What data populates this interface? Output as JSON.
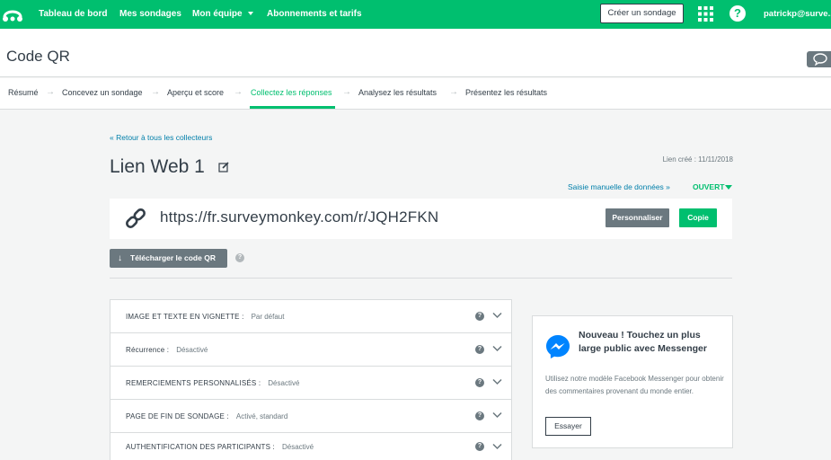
{
  "nav": {
    "links": [
      "Tableau de bord",
      "Mes sondages",
      "Mon équipe",
      "Abonnements et tarifs"
    ],
    "create_button": "Créer un sondage",
    "help_label": "?",
    "user": "patrickp@surve..."
  },
  "header": {
    "title": "Code QR"
  },
  "steps": {
    "items": [
      "Résumé",
      "Concevez un sondage",
      "Aperçu et score",
      "Collectez les réponses",
      "Analysez les résultats",
      "Présentez les résultats"
    ],
    "active_index": 3
  },
  "collector": {
    "back_link": "« Retour à tous les collecteurs",
    "name": "Lien Web 1",
    "created": "Lien créé : 11/11/2018",
    "manual_entry": "Saisie manuelle de données »",
    "status": "OUVERT",
    "url": "https://fr.surveymonkey.com/r/JQH2FKN",
    "personalize_button": "Personnaliser",
    "copy_button": "Copie",
    "download_qr_button": "Télécharger le code QR"
  },
  "settings": [
    {
      "label": "IMAGE ET TEXTE EN VIGNETTE :",
      "value": "Par défaut"
    },
    {
      "label": "Récurrence :",
      "value": "Désactivé"
    },
    {
      "label": "REMERCIEMENTS PERSONNALISÉS :",
      "value": "Désactivé"
    },
    {
      "label": "PAGE DE FIN DE SONDAGE :",
      "value": "Activé, standard"
    },
    {
      "label": "AUTHENTIFICATION DES PARTICIPANTS :",
      "value": "Désactivé"
    }
  ],
  "promo": {
    "title": "Nouveau ! Touchez un plus large public avec Messenger",
    "text": "Utilisez notre modèle Facebook Messenger pour obtenir des commentaires provenant du monde entier.",
    "button": "Essayer"
  },
  "colors": {
    "brand_green": "#00bf6f",
    "link_blue": "#007faa",
    "gray_button": "#6b787f",
    "messenger_blue": "#0084ff"
  }
}
